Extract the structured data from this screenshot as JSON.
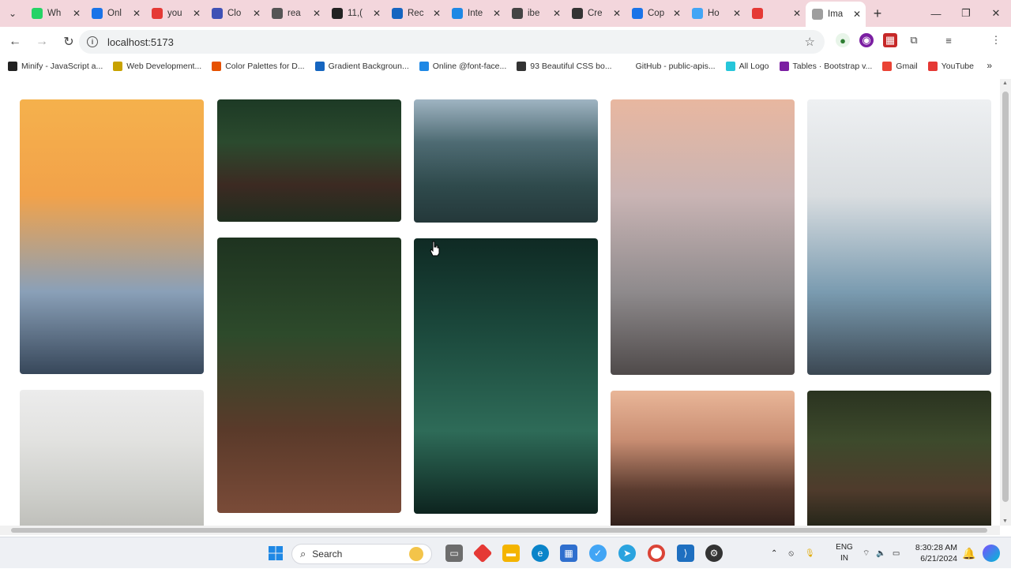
{
  "browser": {
    "tabs": [
      {
        "title": "Wh",
        "color": "#25d366"
      },
      {
        "title": "Onl",
        "color": "#1a73e8"
      },
      {
        "title": "you",
        "color": "#e53935"
      },
      {
        "title": "Clo",
        "color": "#3f51b5"
      },
      {
        "title": "rea",
        "color": "#555555"
      },
      {
        "title": "11,(",
        "color": "#222222"
      },
      {
        "title": "Rec",
        "color": "#1565c0"
      },
      {
        "title": "Inte",
        "color": "#1e88e5"
      },
      {
        "title": "ibe",
        "color": "#444444"
      },
      {
        "title": "Cre",
        "color": "#333333"
      },
      {
        "title": "Cop",
        "color": "#1a73e8"
      },
      {
        "title": "Ho",
        "color": "#42a5f5"
      },
      {
        "title": "",
        "color": "#e53935"
      },
      {
        "title": "Ima",
        "color": "#9e9e9e"
      }
    ],
    "address": "localhost:5173",
    "bookmarks": [
      {
        "label": "Minify - JavaScript a...",
        "color": "#222222"
      },
      {
        "label": "Web Development...",
        "color": "#c8a200"
      },
      {
        "label": "Color Palettes for D...",
        "color": "#e65100"
      },
      {
        "label": "Gradient Backgroun...",
        "color": "#1565c0"
      },
      {
        "label": "Online @font-face...",
        "color": "#1e88e5"
      },
      {
        "label": "93 Beautiful CSS bo...",
        "color": "#333333"
      },
      {
        "label": "GitHub - public-apis...",
        "color": "#ffffff"
      },
      {
        "label": "All Logo",
        "color": "#26c6da"
      },
      {
        "label": "Tables · Bootstrap v...",
        "color": "#7b1fa2"
      },
      {
        "label": "Gmail",
        "color": "#ea4335"
      },
      {
        "label": "YouTube",
        "color": "#e53935"
      }
    ]
  },
  "gallery": {
    "photos": [
      {
        "name": "sunset-couple-silhouette",
        "colors": [
          "#f5b14c",
          "#f2a24a",
          "#8aa0b8",
          "#37475a"
        ]
      },
      {
        "name": "couple-in-forest",
        "colors": [
          "#1d3a25",
          "#2b4a2e",
          "#3c2a22",
          "#1f2e1f"
        ]
      },
      {
        "name": "mountain-valley",
        "colors": [
          "#9fb4c2",
          "#4e6b73",
          "#2f4a4c",
          "#24383a"
        ]
      },
      {
        "name": "couple-walking-beach",
        "colors": [
          "#e8b7a0",
          "#c9b4b4",
          "#8e8a8c",
          "#4f4a4a"
        ]
      },
      {
        "name": "couple-kissing-kitchen",
        "colors": [
          "#eef0f2",
          "#d9dde0",
          "#7a9bb0",
          "#3b4752"
        ]
      },
      {
        "name": "couple-forest-path-dog",
        "colors": [
          "#1e3320",
          "#2d4a2b",
          "#5a3a2a",
          "#7a4b38"
        ]
      },
      {
        "name": "green-leaves",
        "colors": [
          "#0f2a24",
          "#1c4a3d",
          "#2e6b58",
          "#0d241f"
        ]
      },
      {
        "name": "bare-tree",
        "colors": [
          "#ececec",
          "#e2e2e0",
          "#cfd0cc",
          "#bdbdb8"
        ]
      },
      {
        "name": "couple-city-sunset",
        "colors": [
          "#e9b698",
          "#c88d72",
          "#5a3b2f",
          "#2a1c18"
        ]
      },
      {
        "name": "couple-hugging-garden",
        "colors": [
          "#2a3320",
          "#3d4a2c",
          "#4f3b2c",
          "#1e2216"
        ]
      }
    ]
  },
  "taskbar": {
    "search_label": "Search",
    "language_top": "ENG",
    "language_bottom": "IN",
    "time": "8:30:28 AM",
    "date": "6/21/2024"
  }
}
